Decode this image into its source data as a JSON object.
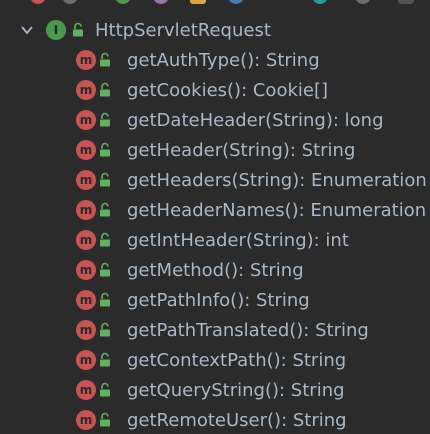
{
  "colors": {
    "background": "#2b2b2b",
    "text": "#a9b7c6",
    "interface_badge": "#4b9a4c",
    "method_badge": "#c75450",
    "lock": "#5fb25f"
  },
  "tree": {
    "root": {
      "label": "HttpServletRequest",
      "expand_icon": "chevron-down-icon",
      "kind_icon": "interface-icon",
      "kind_letter": "I",
      "visibility_icon": "lock-open-icon"
    },
    "members": [
      {
        "label": "getAuthType(): String",
        "kind_letter": "m"
      },
      {
        "label": "getCookies(): Cookie[]",
        "kind_letter": "m"
      },
      {
        "label": "getDateHeader(String): long",
        "kind_letter": "m"
      },
      {
        "label": "getHeader(String): String",
        "kind_letter": "m"
      },
      {
        "label": "getHeaders(String): Enumeration",
        "kind_letter": "m"
      },
      {
        "label": "getHeaderNames(): Enumeration",
        "kind_letter": "m"
      },
      {
        "label": "getIntHeader(String): int",
        "kind_letter": "m"
      },
      {
        "label": "getMethod(): String",
        "kind_letter": "m"
      },
      {
        "label": "getPathInfo(): String",
        "kind_letter": "m"
      },
      {
        "label": "getPathTranslated(): String",
        "kind_letter": "m"
      },
      {
        "label": "getContextPath(): String",
        "kind_letter": "m"
      },
      {
        "label": "getQueryString(): String",
        "kind_letter": "m"
      },
      {
        "label": "getRemoteUser(): String",
        "kind_letter": "m"
      }
    ]
  }
}
